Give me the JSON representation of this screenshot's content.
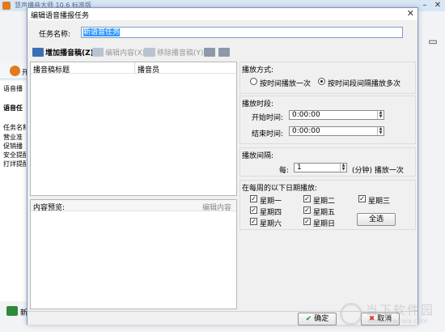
{
  "background_app": {
    "title": "慧声播音大师 10.6 标准版",
    "sidebar_rows": [
      "开",
      "语音播",
      "语音任",
      "任务名称",
      "营业准",
      "促销播",
      "安全提醒",
      "打烊提醒"
    ],
    "bottom_button": "新"
  },
  "dialog": {
    "title": "编辑语音播报任务",
    "task_name_label": "任务名称:",
    "task_name_value": "新语音任务",
    "toolbar": {
      "add_label": "增加播音稿(Z)",
      "edit_label": "编辑内容(X)",
      "remove_label": "移除播音稿(Y)"
    },
    "list_columns": [
      "播音稿标题",
      "播音员"
    ],
    "preview": {
      "label": "内容预览:",
      "edit_link": "编辑内容"
    },
    "play_mode": {
      "title": "播放方式:",
      "option_once": "按时间播放一次",
      "option_interval": "按时间段间隔播放多次",
      "selected": "option_interval"
    },
    "time_range": {
      "title": "播放时段:",
      "start_label": "开始时间:",
      "start_value": "0:00:00",
      "end_label": "结束时间:",
      "end_value": "0:00:00"
    },
    "interval": {
      "title": "播放间隔:",
      "every_label": "每:",
      "value": "1",
      "unit_label": "(分钟) 播放一次"
    },
    "weekdays": {
      "title": "在每周的以下日期播放:",
      "days": [
        "星期一",
        "星期二",
        "星期三",
        "星期四",
        "星期五",
        "星期六",
        "星期日"
      ],
      "checked": [
        true,
        true,
        true,
        true,
        true,
        true,
        true
      ],
      "select_all_label": "全选"
    },
    "ok_label": "确定",
    "cancel_label": "取消"
  },
  "watermark": {
    "main": "当下软件园",
    "sub": "www.downxia.com"
  },
  "colors": {
    "accent": "#3399ff",
    "dialog_border": "#7a9cc4",
    "ok_icon": "#2e8b3c",
    "cancel_icon": "#d63a2f"
  }
}
